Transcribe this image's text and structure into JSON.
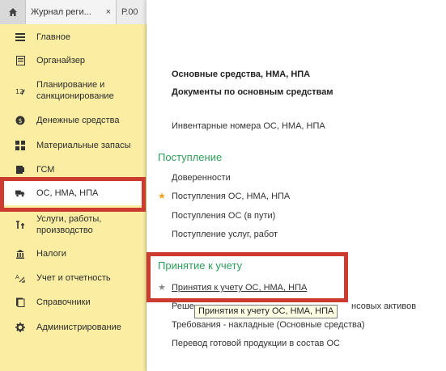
{
  "tabs": [
    {
      "label": "Журнал реги...",
      "close": "×"
    },
    {
      "label": "Р.00"
    }
  ],
  "sidebar": {
    "items": [
      {
        "label": "Главное",
        "icon": "menu-icon"
      },
      {
        "label": "Органайзер",
        "icon": "organizer-icon"
      },
      {
        "label": "Планирование и санкционирование",
        "icon": "planning-icon"
      },
      {
        "label": "Денежные средства",
        "icon": "money-icon"
      },
      {
        "label": "Материальные запасы",
        "icon": "inventory-icon"
      },
      {
        "label": "ГСМ",
        "icon": "fuel-icon"
      },
      {
        "label": "ОС, НМА, НПА",
        "icon": "truck-icon"
      },
      {
        "label": "Услуги, работы, производство",
        "icon": "services-icon"
      },
      {
        "label": "Налоги",
        "icon": "taxes-icon"
      },
      {
        "label": "Учет и отчетность",
        "icon": "reporting-icon"
      },
      {
        "label": "Справочники",
        "icon": "reference-icon"
      },
      {
        "label": "Администрирование",
        "icon": "gear-icon"
      }
    ]
  },
  "panel": {
    "header_links": [
      "Основные средства, НМА, НПА",
      "Документы по основным средствам"
    ],
    "inventory_link": "Инвентарные номера ОС, НМА, НПА",
    "section_receipt": {
      "title": "Поступление",
      "links": [
        "Доверенности",
        "Поступления ОС, НМА, НПА",
        "Поступления ОС (в пути)",
        "Поступление услуг, работ"
      ]
    },
    "section_accept": {
      "title": "Принятие к учету",
      "links": [
        "Принятия к учету ОС, НМА, НПА",
        "Реше",
        "нсовых активов",
        "Требования - накладные (Основные средства)",
        "Перевод готовой продукции в состав ОС"
      ]
    },
    "tooltip": "Принятия к учету ОС, НМА, НПА"
  },
  "colors": {
    "sidebar_bg": "#fbeea3",
    "section_green": "#2e9d5a",
    "highlight_red": "#cc3b2f",
    "star_orange": "#f0a020"
  }
}
